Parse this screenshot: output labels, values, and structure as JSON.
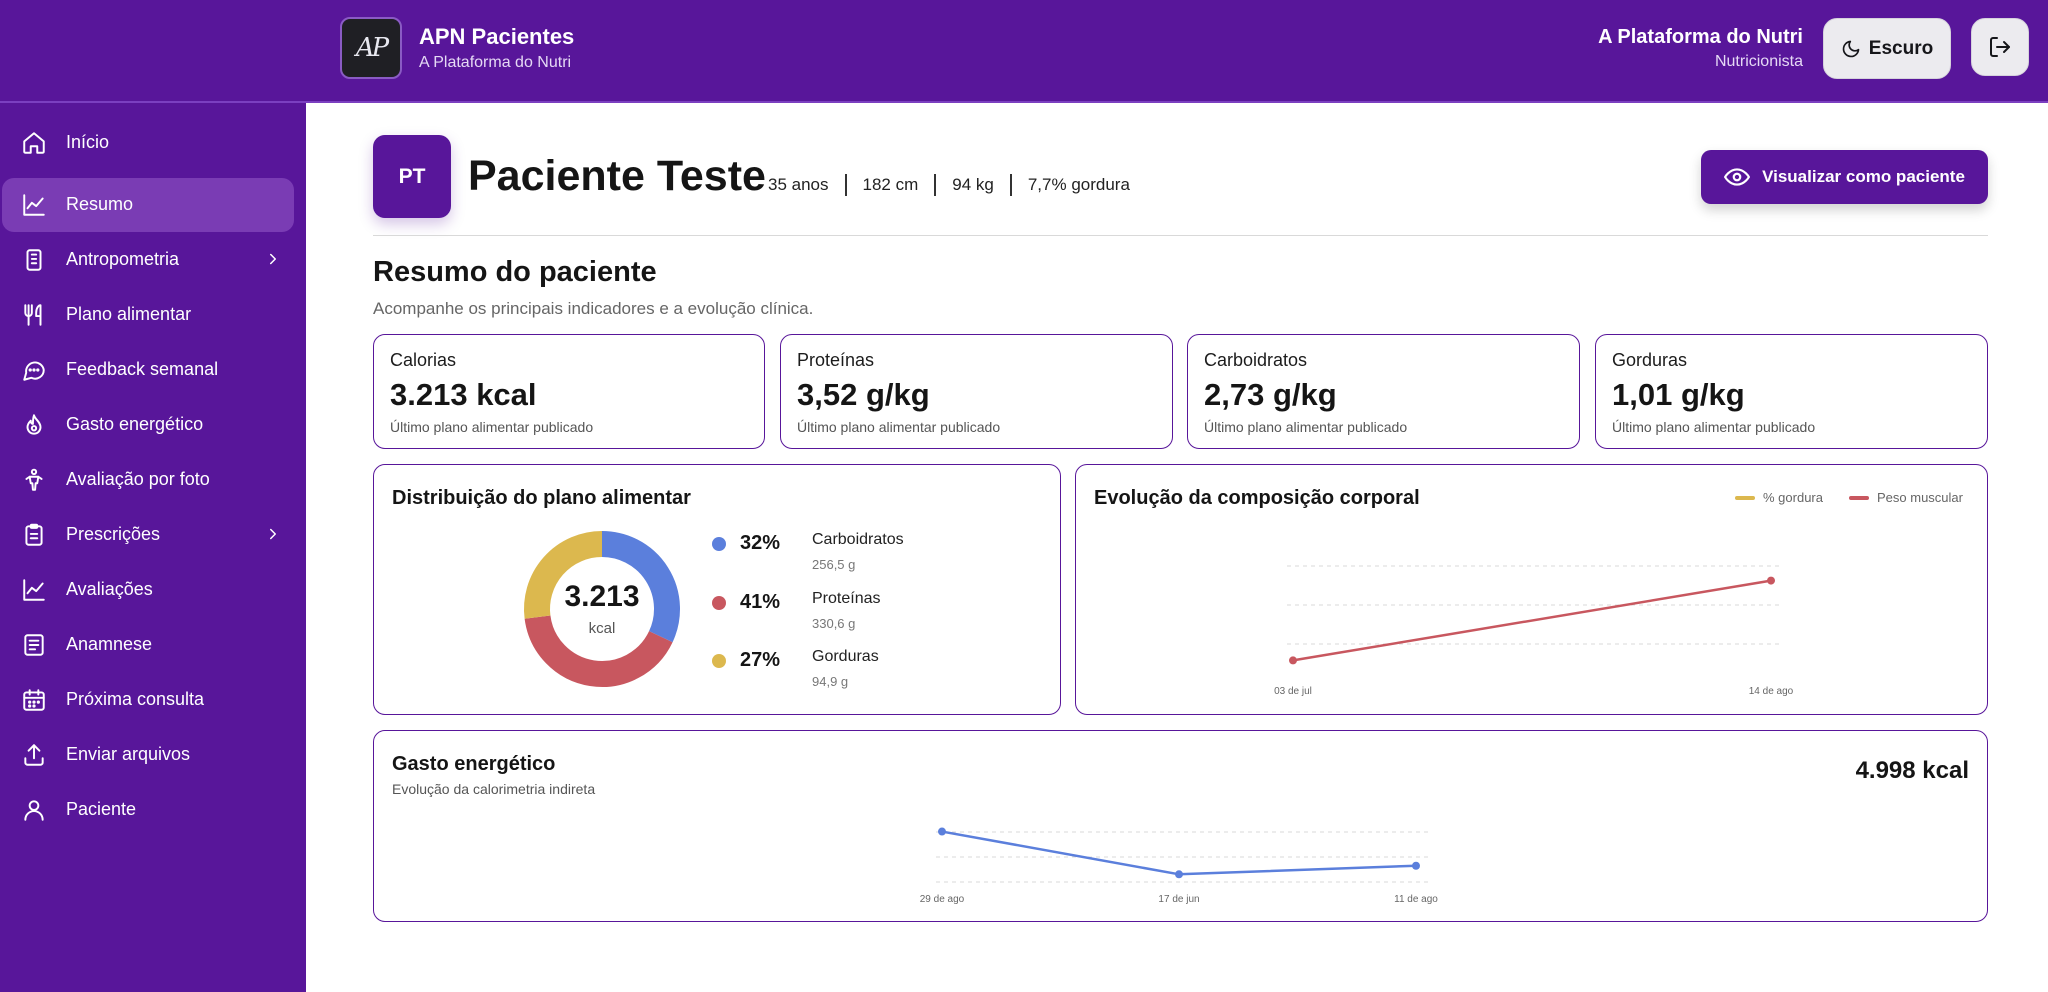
{
  "header": {
    "logo_text": "AP",
    "app_title": "APN Pacientes",
    "app_subtitle": "A Plataforma do Nutri",
    "user_name": "A Plataforma do Nutri",
    "user_role": "Nutricionista",
    "theme_label": "Escuro"
  },
  "sidebar": {
    "items": [
      {
        "label": "Início",
        "icon": "home-icon"
      },
      {
        "label": "Resumo",
        "icon": "chart-line-icon",
        "active": true
      },
      {
        "label": "Antropometria",
        "icon": "ruler-icon",
        "has_submenu": true
      },
      {
        "label": "Plano alimentar",
        "icon": "utensils-icon"
      },
      {
        "label": "Feedback semanal",
        "icon": "chat-icon"
      },
      {
        "label": "Gasto energético",
        "icon": "flame-icon"
      },
      {
        "label": "Avaliação por foto",
        "icon": "person-icon"
      },
      {
        "label": "Prescrições",
        "icon": "clipboard-icon",
        "has_submenu": true
      },
      {
        "label": "Avaliações",
        "icon": "chart-line-icon"
      },
      {
        "label": "Anamnese",
        "icon": "document-icon"
      },
      {
        "label": "Próxima consulta",
        "icon": "calendar-icon"
      },
      {
        "label": "Enviar arquivos",
        "icon": "upload-icon"
      },
      {
        "label": "Paciente",
        "icon": "user-icon"
      }
    ]
  },
  "patient": {
    "initials": "PT",
    "name": "Paciente Teste",
    "age": "35 anos",
    "height": "182 cm",
    "weight": "94 kg",
    "body_fat": "7,7% gordura",
    "view_button": "Visualizar como paciente"
  },
  "summary": {
    "title": "Resumo do paciente",
    "subtitle": "Acompanhe os principais indicadores e a evolução clínica."
  },
  "stats": [
    {
      "label": "Calorias",
      "value": "3.213 kcal",
      "sub": "Último plano alimentar publicado"
    },
    {
      "label": "Proteínas",
      "value": "3,52 g/kg",
      "sub": "Último plano alimentar publicado"
    },
    {
      "label": "Carboidratos",
      "value": "2,73 g/kg",
      "sub": "Último plano alimentar publicado"
    },
    {
      "label": "Gorduras",
      "value": "1,01 g/kg",
      "sub": "Último plano alimentar publicado"
    }
  ],
  "distribution": {
    "title": "Distribuição do plano alimentar",
    "center_value": "3.213",
    "center_unit": "kcal",
    "items": [
      {
        "pct_label": "32%",
        "name": "Carboidratos",
        "grams": "256,5 g",
        "color": "#5b7fdc"
      },
      {
        "pct_label": "41%",
        "name": "Proteínas",
        "grams": "330,6 g",
        "color": "#c8575f"
      },
      {
        "pct_label": "27%",
        "name": "Gorduras",
        "grams": "94,9 g",
        "color": "#dcb84e"
      }
    ]
  },
  "body_composition": {
    "title": "Evolução da composição corporal",
    "legend": [
      {
        "label": "% gordura",
        "color": "#dcb84e"
      },
      {
        "label": "Peso muscular",
        "color": "#c8575f"
      }
    ]
  },
  "energy": {
    "title": "Gasto energético",
    "subtitle": "Evolução da calorimetria indireta",
    "total": "4.998 kcal"
  },
  "chart_data": [
    {
      "type": "pie",
      "categories": [
        "Carboidratos",
        "Proteínas",
        "Gorduras"
      ],
      "values": [
        32,
        41,
        27
      ],
      "colors": [
        "#5b7fdc",
        "#c8575f",
        "#dcb84e"
      ]
    },
    {
      "type": "line",
      "x": [
        "03 de jul",
        "14 de ago"
      ],
      "series": [
        {
          "name": "Peso muscular",
          "values": [
            0.2,
            0.8
          ],
          "color": "#c8575f"
        }
      ],
      "ylim": [
        0,
        1
      ],
      "grid": true
    },
    {
      "type": "line",
      "x": [
        "29 de ago",
        "17 de jun",
        "11 de ago"
      ],
      "series": [
        {
          "values": [
            0.85,
            0.1,
            0.25
          ],
          "color": "#5b7fdc"
        }
      ],
      "ylim": [
        0,
        1
      ],
      "grid": true
    }
  ]
}
